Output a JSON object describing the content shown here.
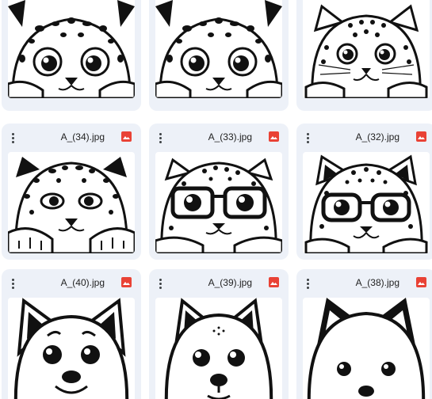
{
  "grid": {
    "rows": [
      {
        "cards": [
          {
            "filename": "",
            "icon": "leopard-peeking-icon"
          },
          {
            "filename": "",
            "icon": "leopard-peeking-icon"
          },
          {
            "filename": "",
            "icon": "leopard-peeking-icon"
          }
        ]
      },
      {
        "cards": [
          {
            "filename": "A_(34).jpg",
            "icon": "leopard-peeking-icon"
          },
          {
            "filename": "A_(33).jpg",
            "icon": "leopard-glasses-icon"
          },
          {
            "filename": "A_(32).jpg",
            "icon": "leopard-glasses-icon"
          }
        ]
      },
      {
        "cards": [
          {
            "filename": "A_(40).jpg",
            "icon": "puppy-peeking-icon"
          },
          {
            "filename": "A_(39).jpg",
            "icon": "puppy-peeking-icon"
          },
          {
            "filename": "A_(38).jpg",
            "icon": "puppy-peeking-icon"
          }
        ]
      }
    ]
  },
  "colors": {
    "card_bg": "#edf1f8",
    "image_badge": "#e94235",
    "text": "#1f1f1f"
  }
}
